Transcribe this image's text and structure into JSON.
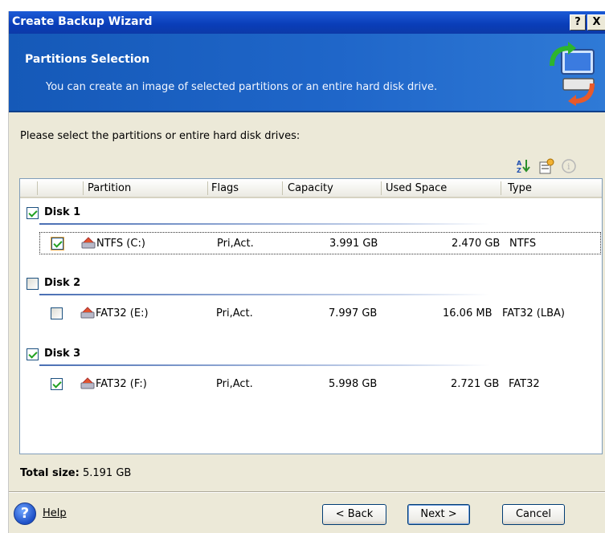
{
  "window": {
    "title": "Create Backup Wizard",
    "help_btn": "?",
    "close_btn": "X"
  },
  "header": {
    "title": "Partitions Selection",
    "subtitle": "You can create an image of selected partitions or an entire hard disk drive."
  },
  "prompt": "Please select the partitions or entire hard disk drives:",
  "toolbar": {
    "icons": [
      "sort-icon",
      "properties-icon",
      "info-icon"
    ]
  },
  "columns": [
    "Partition",
    "Flags",
    "Capacity",
    "Used Space",
    "Type"
  ],
  "disks": [
    {
      "label": "Disk 1",
      "checked": true,
      "partition": {
        "name": "NTFS (C:)",
        "flags": "Pri,Act.",
        "capacity": "3.991 GB",
        "used": "2.470 GB",
        "type": "NTFS",
        "checked": true
      }
    },
    {
      "label": "Disk 2",
      "checked": false,
      "partition": {
        "name": "FAT32 (E:)",
        "flags": "Pri,Act.",
        "capacity": "7.997 GB",
        "used": "16.06 MB",
        "type": "FAT32 (LBA)",
        "checked": false
      }
    },
    {
      "label": "Disk 3",
      "checked": true,
      "partition": {
        "name": "FAT32 (F:)",
        "flags": "Pri,Act.",
        "capacity": "5.998 GB",
        "used": "2.721 GB",
        "type": "FAT32",
        "checked": true
      }
    }
  ],
  "total": {
    "label": "Total size:",
    "value": "5.191 GB"
  },
  "footer": {
    "help": "Help",
    "back": "< Back",
    "next": "Next >",
    "cancel": "Cancel"
  }
}
